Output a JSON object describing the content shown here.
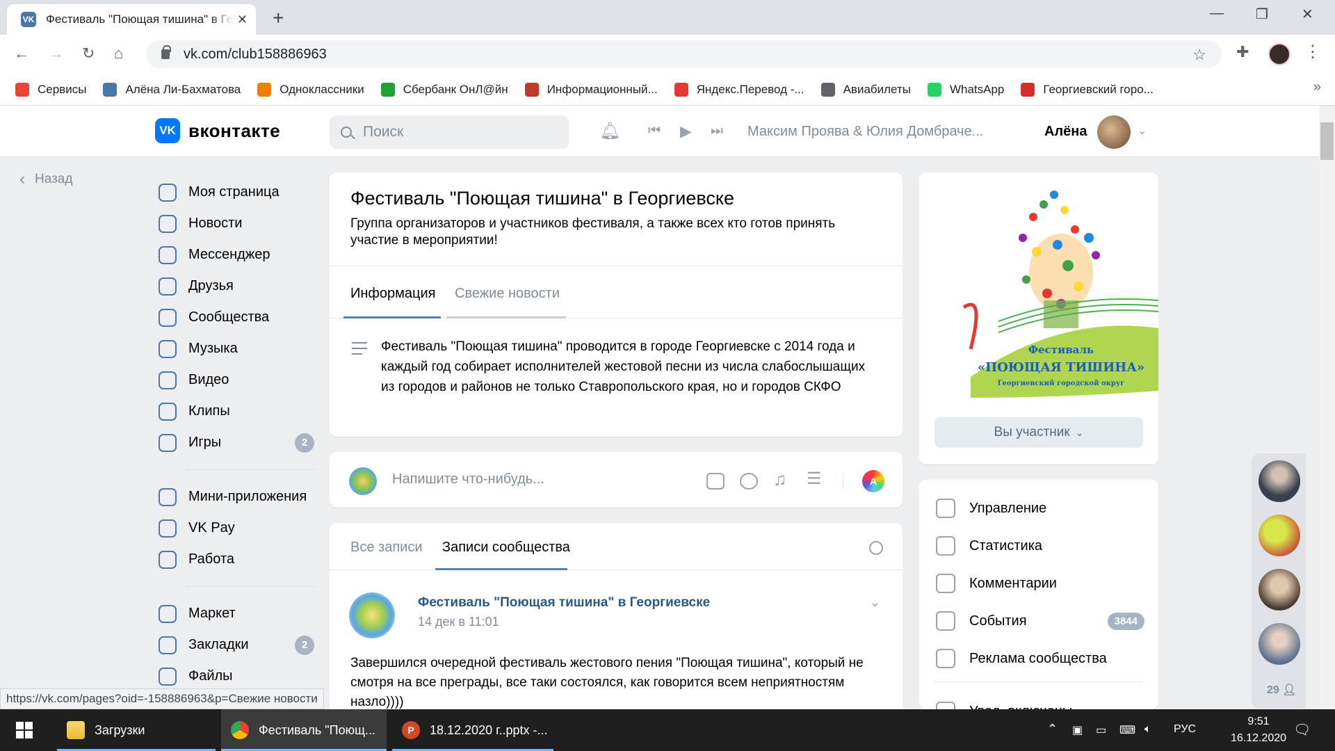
{
  "browser": {
    "tab_title": "Фестиваль \"Поющая тишина\" в Георгиевске",
    "url": "vk.com/club158886963",
    "bookmarks": [
      {
        "label": "Сервисы",
        "icon": "apps-grid-icon",
        "color": "#ea4335"
      },
      {
        "label": "Алёна Ли-Бахматова",
        "icon": "vk-icon",
        "color": "#4a76a8"
      },
      {
        "label": "Одноклассники",
        "icon": "ok-icon",
        "color": "#ee8208"
      },
      {
        "label": "Сбербанк ОнЛ@йн",
        "icon": "sberbank-icon",
        "color": "#21a038"
      },
      {
        "label": "Информационный...",
        "icon": "kdm-icon",
        "color": "#c0392b"
      },
      {
        "label": "Яндекс.Перевод -...",
        "icon": "yandex-translate-icon",
        "color": "#e53935"
      },
      {
        "label": "Авиабилеты",
        "icon": "globe-icon",
        "color": "#5f6368"
      },
      {
        "label": "WhatsApp",
        "icon": "whatsapp-icon",
        "color": "#25d366"
      },
      {
        "label": "Георгиевский горо...",
        "icon": "city-emblem-icon",
        "color": "#d32f2f"
      }
    ]
  },
  "vk": {
    "logo_text": "вконтакте",
    "search_placeholder": "Поиск",
    "now_playing": "Максим Проява & Юлия Домбраче...",
    "user_name": "Алёна",
    "back_label": "Назад",
    "menu_main": [
      {
        "label": "Моя страница",
        "icon": "user-circle-icon"
      },
      {
        "label": "Новости",
        "icon": "news-icon"
      },
      {
        "label": "Мессенджер",
        "icon": "message-icon"
      },
      {
        "label": "Друзья",
        "icon": "friends-icon"
      },
      {
        "label": "Сообщества",
        "icon": "communities-icon"
      },
      {
        "label": "Музыка",
        "icon": "music-note-icon"
      },
      {
        "label": "Видео",
        "icon": "video-play-icon"
      },
      {
        "label": "Клипы",
        "icon": "clips-icon"
      },
      {
        "label": "Игры",
        "icon": "gamepad-icon",
        "badge": "2"
      }
    ],
    "menu_apps": [
      {
        "label": "Мини-приложения",
        "icon": "mini-apps-icon"
      },
      {
        "label": "VK Pay",
        "icon": "vk-pay-icon"
      },
      {
        "label": "Работа",
        "icon": "briefcase-icon"
      }
    ],
    "menu_more": [
      {
        "label": "Маркет",
        "icon": "market-bag-icon"
      },
      {
        "label": "Закладки",
        "icon": "star-icon",
        "badge": "2"
      },
      {
        "label": "Файлы",
        "icon": "file-icon"
      }
    ]
  },
  "group": {
    "title": "Фестиваль \"Поющая тишина\" в Георгиевске",
    "description": "Группа организаторов и участников фестиваля, а также всех кто готов принять участие в мероприятии!",
    "tabs": [
      "Информация",
      "Свежие новости"
    ],
    "info_text": "Фестиваль \"Поющая тишина\" проводится в городе Георгиевске с 2014 года и каждый год собирает исполнителей жестовой песни из числа слабослышащих из городов и районов не только Ставропольского края, но и городов СКФО",
    "composer_placeholder": "Напишите что-нибудь...",
    "wall_tabs": [
      "Все записи",
      "Записи сообщества"
    ],
    "post": {
      "author": "Фестиваль \"Поющая тишина\" в Георгиевске",
      "date": "14 дек в 11:01",
      "text": "Завершился очередной фестиваль жестового пения \"Поющая тишина\", который не смотря на все преграды, все таки состоялся, как говорится всем неприятностям назло))))"
    },
    "cover_text": {
      "line1": "Фестиваль",
      "line2": "«ПОЮЩАЯ ТИШИНА»",
      "line3": "Георгиевский городской округ"
    },
    "member_button": "Вы участник",
    "admin_menu": [
      {
        "label": "Управление",
        "icon": "gear-icon"
      },
      {
        "label": "Статистика",
        "icon": "stats-bars-icon"
      },
      {
        "label": "Комментарии",
        "icon": "comment-icon"
      },
      {
        "label": "События",
        "icon": "events-icon",
        "badge": "3844"
      },
      {
        "label": "Реклама сообщества",
        "icon": "megaphone-icon"
      },
      {
        "label": "Увед. включены",
        "icon": "check-circle-icon"
      }
    ],
    "online_friends_count": "29"
  },
  "status_url": "https://vk.com/pages?oid=-158886963&p=Свежие новости",
  "taskbar": {
    "items": [
      {
        "label": "Загрузки",
        "icon": "folder-icon"
      },
      {
        "label": "Фестиваль \"Поющ...",
        "icon": "chrome-icon"
      },
      {
        "label": "18.12.2020 г..pptx -...",
        "icon": "powerpoint-icon"
      }
    ],
    "lang": "РУС",
    "time": "9:51",
    "date": "16.12.2020"
  },
  "colors": {
    "vk_blue": "#0077ff",
    "link": "#2a5885",
    "accent": "#4a76a8"
  }
}
